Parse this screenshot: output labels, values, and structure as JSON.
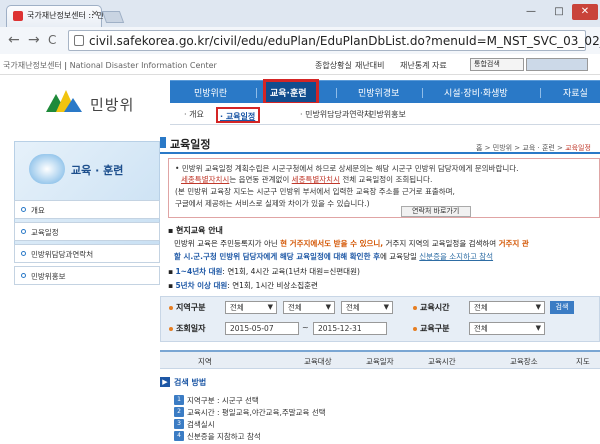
{
  "browser": {
    "tab_title": "국가재난정보센터 :: 민방",
    "tab_close": "×",
    "minimize": "—",
    "maximize": "□",
    "close": "✕",
    "url": "civil.safekorea.go.kr/civil/edu/eduPlan/EduPlanDbList.do?menuId=M_NST_SVC_03_02_02",
    "back": "←",
    "forward": "→",
    "reload": "C"
  },
  "topbar": {
    "brand": "국가재난정보센터",
    "brand_en": "National Disaster Information Center",
    "links": [
      "종합상황실",
      "재난대비",
      "재난통계 자료"
    ],
    "search_select": "통합검색"
  },
  "logo": {
    "text": "민방위"
  },
  "gnb": {
    "items": [
      "민방위란",
      "교육·훈련",
      "민방위경보",
      "시설·장비·화생방",
      "자료실"
    ],
    "active": "교육·훈련"
  },
  "subnav": {
    "items": [
      "· 개요",
      "· 교육일정",
      "· 민방위담당과연락처",
      "· 민방위홍보"
    ]
  },
  "sidebar": {
    "title": "교육 · 훈련",
    "items": [
      "개요",
      "교육일정",
      "민방위담당과연락처",
      "민방위홍보"
    ]
  },
  "content": {
    "title": "교육일정",
    "breadcrumb_prefix": "홈 > 민방위 > 교육 · 훈련 >",
    "breadcrumb_current": "교육일정",
    "notice": {
      "line1": "민방위 교육일정 계획수립은 시군구청에서 하므로 상세문의는 해당 시군구 민방위 담당자에게 문의바랍니다.",
      "line2a": "세종특별자치시",
      "line2b": "는 읍면동 관계없이",
      "line2c": "세종특별자치시",
      "line2d": "전체 교육일정이 조회됩니다.",
      "line3": "(본 민방위 교육장 지도는 시군구 민방위 부서에서 입력한 교육장 주소를 근거로 표출하며,",
      "line4": "구글에서 제공하는 서비스로 실제와 차이가 있을 수 있습니다.)",
      "contact_button": "연락처 바로가기"
    },
    "guide": {
      "heading": "현지교육 안내",
      "p1a": "민방위 교육은 주민등록지가 아닌",
      "p1b": "현 거주지에서도 받을 수 있으니,",
      "p1c": "거주지 지역의 교육일정을 검색하여",
      "p1d": "거주지 관",
      "p2a": "할 시.군.구청 민방위 담당자에게 해당 교육일정에 대해 확인한 후",
      "p2b": "에 교육당일",
      "p2c": "신분증을 소지하고 참석",
      "item1_label": "1~4년차 대원",
      "item1_text": ": 연1회, 4시간 교육(1년차 대원=신편대원)",
      "item2_label": "5년차 이상 대원",
      "item2_text": ": 연1회, 1시간 비상소집훈련"
    },
    "filter": {
      "region_label": "지역구분",
      "region_values": [
        "전체",
        "전체",
        "전체"
      ],
      "time_label": "교육시간",
      "time_value": "전체",
      "date_label": "조회일자",
      "date_from": "2015-05-07",
      "date_sep": "~",
      "date_to": "2015-12-31",
      "type_label": "교육구분",
      "type_value": "전체",
      "search_button": "검색"
    },
    "table_headers": [
      "지역",
      "교육대상",
      "교육일자",
      "교육시간",
      "교육장소",
      "지도"
    ],
    "method": {
      "heading": "검색 방법",
      "steps": [
        "지역구분 : 시군구 선택",
        "교육시간 : 평일교육,야간교육,주말교육 선택",
        "검색실시",
        "신분증을 지참하고 참석"
      ]
    }
  },
  "colors": {
    "primary": "#2a79c7",
    "highlight_box": "#d42525",
    "accent": "#e67e22"
  }
}
